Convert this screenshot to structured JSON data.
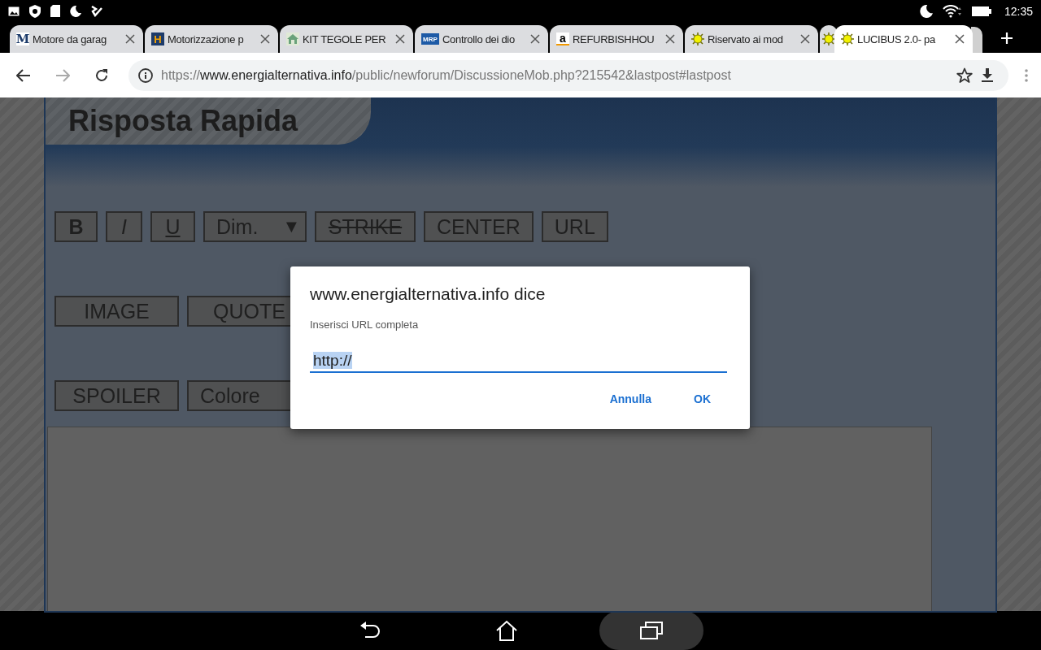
{
  "status_bar": {
    "time": "12:35"
  },
  "tabs": [
    {
      "title": "Motore da garag",
      "favicon": {
        "kind": "letter",
        "text": "M"
      },
      "selected": false
    },
    {
      "title": "Motorizzazione p",
      "favicon": {
        "kind": "badge",
        "text": "H"
      },
      "selected": false
    },
    {
      "title": "KIT TEGOLE PER",
      "favicon": {
        "kind": "house"
      },
      "selected": false
    },
    {
      "title": "Controllo dei dio",
      "favicon": {
        "kind": "badge-small",
        "text": "MRP"
      },
      "selected": false
    },
    {
      "title": "REFURBISHHOU",
      "favicon": {
        "kind": "amazon",
        "text": "a"
      },
      "selected": false
    },
    {
      "title": "Riservato ai mod",
      "favicon": {
        "kind": "sun"
      },
      "selected": false
    },
    {
      "favicon": {
        "kind": "sun"
      },
      "selected": false
    },
    {
      "title": "LUCIBUS 2.0- pa",
      "favicon": {
        "kind": "sun"
      },
      "selected": true
    }
  ],
  "address_bar": {
    "scheme": "https://",
    "host": "www.energialternativa.info",
    "path": "/public/newforum/DiscussioneMob.php?215542&lastpost#lastpost"
  },
  "page": {
    "title": "Risposta Rapida",
    "toolbar_rows": [
      [
        {
          "label": "B",
          "kind": "bold"
        },
        {
          "label": "I",
          "kind": "italic"
        },
        {
          "label": "U",
          "kind": "underline"
        },
        {
          "label": "Dim.",
          "kind": "dropdown",
          "caret": "▼"
        },
        {
          "label": "STRIKE",
          "kind": "strike"
        },
        {
          "label": "CENTER",
          "kind": "plain"
        },
        {
          "label": "URL",
          "kind": "plain"
        }
      ],
      [
        {
          "label": "IMAGE",
          "kind": "wide"
        },
        {
          "label": "QUOTE",
          "kind": "wide"
        }
      ],
      [
        {
          "label": "SPOILER",
          "kind": "wide"
        },
        {
          "label": "Colore",
          "kind": "select"
        }
      ]
    ]
  },
  "dialog": {
    "title": "www.energialternativa.info dice",
    "message": "Inserisci URL completa",
    "value": "http://",
    "buttons": [
      "Annulla",
      "OK"
    ]
  }
}
